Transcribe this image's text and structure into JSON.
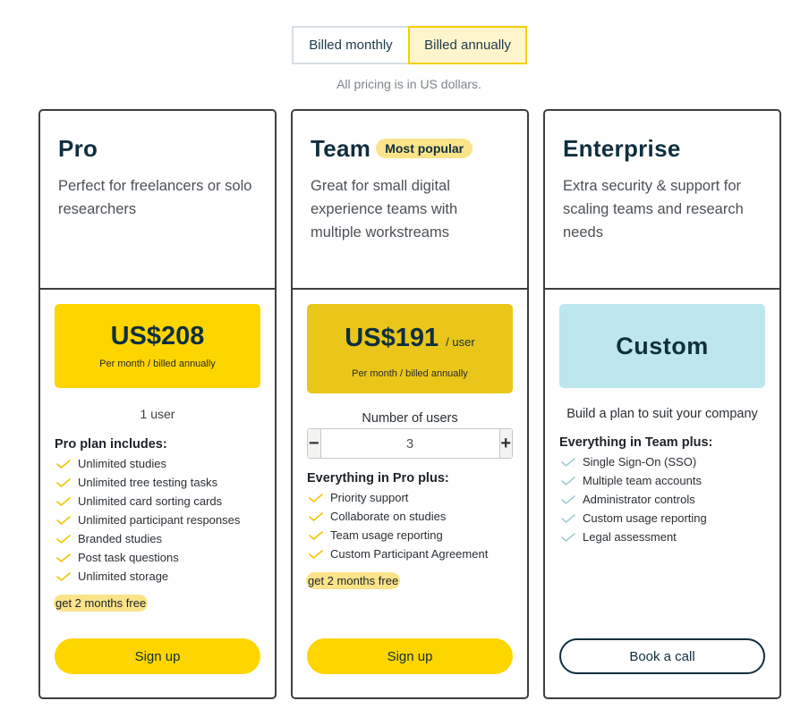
{
  "billing": {
    "monthly_label": "Billed monthly",
    "annually_label": "Billed annually",
    "selected": "annually",
    "note": "All pricing is in US dollars."
  },
  "plans": {
    "pro": {
      "title": "Pro",
      "description": "Perfect for freelancers or solo researchers",
      "price": "US$208",
      "price_sub": "Per month / billed annually",
      "users": "1 user",
      "includes_title": "Pro plan includes:",
      "features": [
        "Unlimited studies",
        "Unlimited tree testing tasks",
        "Unlimited card sorting cards",
        "Unlimited participant responses",
        "Branded studies",
        "Post task questions",
        "Unlimited storage"
      ],
      "promo": "get 2 months free",
      "cta": "Sign up"
    },
    "team": {
      "title": "Team",
      "badge": "Most popular",
      "description": "Great for small digital experience teams with multiple workstreams",
      "price": "US$191",
      "per_user": "/ user",
      "price_sub": "Per month / billed annually",
      "users_label": "Number of users",
      "users_value": "3",
      "minus": "−",
      "plus": "+",
      "includes_title": "Everything in Pro plus:",
      "features": [
        "Priority support",
        "Collaborate on studies",
        "Team usage reporting",
        "Custom Participant Agreement"
      ],
      "promo": "get 2 months free",
      "cta": "Sign up"
    },
    "enterprise": {
      "title": "Enterprise",
      "description": "Extra security & support for scaling teams and research needs",
      "price": "Custom",
      "subtitle": "Build a plan to suit your company",
      "includes_title": "Everything in Team plus:",
      "features": [
        "Single Sign-On (SSO)",
        "Multiple team accounts",
        "Administrator controls",
        "Custom usage reporting",
        "Legal assessment"
      ],
      "cta": "Book a call"
    }
  },
  "colors": {
    "brand_yellow": "#ffd500",
    "team_price_bg": "#eac61b",
    "enterprise_price_bg": "#bde6ef",
    "badge_bg": "#fbe38a",
    "text_dark": "#0f2f3f",
    "check_yellow": "#f2c500",
    "check_teal": "#9fcfd6"
  }
}
